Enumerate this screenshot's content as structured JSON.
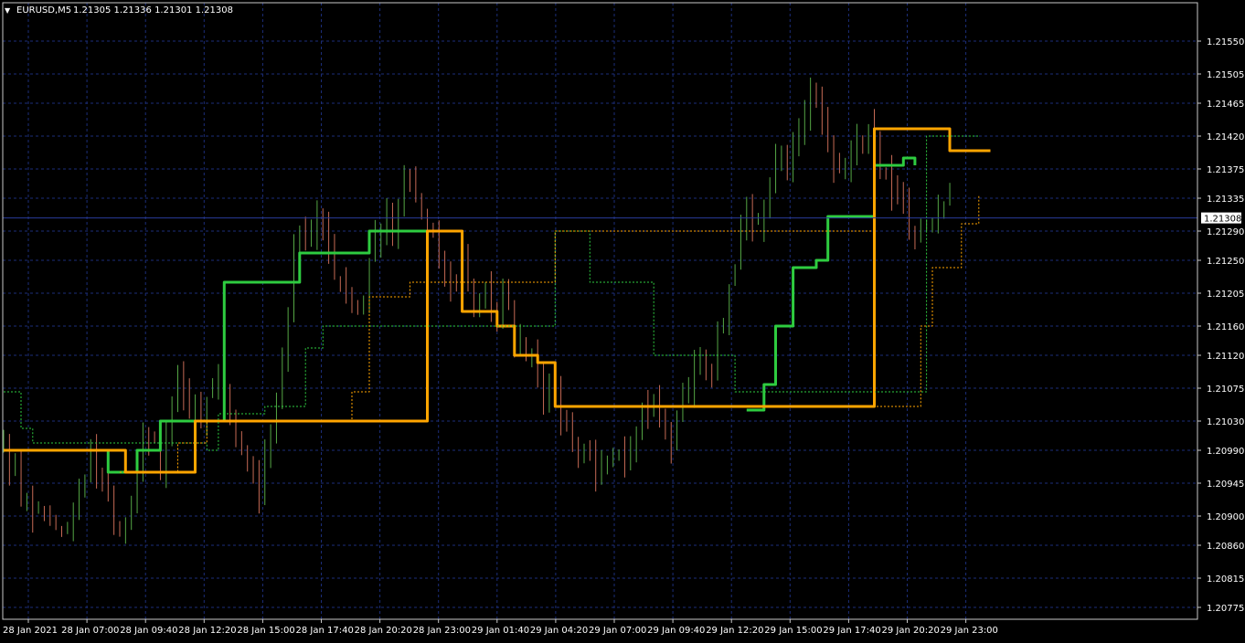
{
  "header": {
    "menu_glyph": "▼",
    "symbol_label": "EURUSD,M5",
    "ohlc_label": "1.21305 1.21336 1.21301 1.21308"
  },
  "colors": {
    "background": "#000000",
    "grid": "#1c2e7a",
    "frame": "#c8c8c8",
    "axis_text": "#ffffff",
    "bull_candle": "#55a645",
    "bear_candle": "#c66a55",
    "green_line": "#2ecc40",
    "orange_line": "#ffa500",
    "price_line": "#2a3c9a"
  },
  "chart_data": {
    "type": "candlestick",
    "symbol": "EURUSD",
    "timeframe": "M5",
    "ylim": [
      1.20775,
      1.21575
    ],
    "y_ticks": [
      "1.21550",
      "1.21505",
      "1.21465",
      "1.21420",
      "1.21375",
      "1.21335",
      "1.21290",
      "1.21250",
      "1.21205",
      "1.21160",
      "1.21120",
      "1.21075",
      "1.21030",
      "1.20990",
      "1.20945",
      "1.20900",
      "1.20860",
      "1.20815",
      "1.20775"
    ],
    "x_ticks": [
      "28 Jan 2021",
      "28 Jan 07:00",
      "28 Jan 09:40",
      "28 Jan 12:20",
      "28 Jan 15:00",
      "28 Jan 17:40",
      "28 Jan 20:20",
      "28 Jan 23:00",
      "29 Jan 01:40",
      "29 Jan 04:20",
      "29 Jan 07:00",
      "29 Jan 09:40",
      "29 Jan 12:20",
      "29 Jan 15:00",
      "29 Jan 17:40",
      "29 Jan 20:20",
      "29 Jan 23:00"
    ],
    "current_price": "1.21308",
    "close_path": [
      [
        0,
        1.20985
      ],
      [
        1,
        1.2096
      ],
      [
        2,
        1.2092
      ],
      [
        3,
        1.2088
      ],
      [
        4,
        1.2091
      ],
      [
        5,
        1.20895
      ],
      [
        6,
        1.2088
      ],
      [
        7,
        1.2092
      ],
      [
        8,
        1.2096
      ],
      [
        9,
        1.2099
      ],
      [
        10,
        1.2094
      ],
      [
        11,
        1.2088
      ],
      [
        12,
        1.2086
      ],
      [
        13,
        1.2093
      ],
      [
        14,
        1.2099
      ],
      [
        15,
        1.2102
      ],
      [
        16,
        1.2097
      ],
      [
        17,
        1.2105
      ],
      [
        18,
        1.211
      ],
      [
        19,
        1.2106
      ],
      [
        20,
        1.2101
      ],
      [
        21,
        1.2106
      ],
      [
        22,
        1.2109
      ],
      [
        23,
        1.2103
      ],
      [
        24,
        1.21
      ],
      [
        25,
        1.2096
      ],
      [
        26,
        1.2092
      ],
      [
        27,
        1.2099
      ],
      [
        28,
        1.2105
      ],
      [
        29,
        1.212
      ],
      [
        30,
        1.2129
      ],
      [
        31,
        1.2126
      ],
      [
        32,
        1.2131
      ],
      [
        33,
        1.2126
      ],
      [
        34,
        1.2123
      ],
      [
        35,
        1.2121
      ],
      [
        36,
        1.2119
      ],
      [
        37,
        1.2122
      ],
      [
        38,
        1.2127
      ],
      [
        39,
        1.2131
      ],
      [
        40,
        1.213
      ],
      [
        41,
        1.2137
      ],
      [
        42,
        1.2134
      ],
      [
        43,
        1.2131
      ],
      [
        44,
        1.2126
      ],
      [
        45,
        1.2122
      ],
      [
        46,
        1.2118
      ],
      [
        47,
        1.2125
      ],
      [
        48,
        1.212
      ],
      [
        49,
        1.2123
      ],
      [
        50,
        1.2118
      ],
      [
        51,
        1.212
      ],
      [
        52,
        1.2115
      ],
      [
        53,
        1.211
      ],
      [
        54,
        1.2112
      ],
      [
        55,
        1.2108
      ],
      [
        56,
        1.2105
      ],
      [
        57,
        1.2103
      ],
      [
        58,
        1.21
      ],
      [
        59,
        1.2098
      ],
      [
        60,
        1.2096
      ],
      [
        61,
        1.2097
      ],
      [
        62,
        1.2099
      ],
      [
        63,
        1.2096
      ],
      [
        64,
        1.21
      ],
      [
        65,
        1.2104
      ],
      [
        66,
        1.2106
      ],
      [
        67,
        1.2102
      ],
      [
        68,
        1.21
      ],
      [
        69,
        1.2104
      ],
      [
        70,
        1.2108
      ],
      [
        71,
        1.2112
      ],
      [
        72,
        1.211
      ],
      [
        73,
        1.2116
      ],
      [
        74,
        1.2122
      ],
      [
        75,
        1.2127
      ],
      [
        76,
        1.2132
      ],
      [
        77,
        1.213
      ],
      [
        78,
        1.2136
      ],
      [
        79,
        1.214
      ],
      [
        80,
        1.2138
      ],
      [
        81,
        1.2143
      ],
      [
        82,
        1.2146
      ],
      [
        83,
        1.2149
      ],
      [
        84,
        1.2142
      ],
      [
        85,
        1.2136
      ],
      [
        86,
        1.2139
      ],
      [
        87,
        1.2142
      ],
      [
        88,
        1.2143
      ],
      [
        89,
        1.2139
      ],
      [
        90,
        1.2135
      ],
      [
        91,
        1.2132
      ],
      [
        92,
        1.213
      ],
      [
        93,
        1.2129
      ],
      [
        94,
        1.2131
      ],
      [
        95,
        1.213
      ],
      [
        96,
        1.2134
      ],
      [
        97,
        1.21308
      ]
    ],
    "series": [
      {
        "name": "",
        "color": "#2ecc40",
        "style": "solid-thick",
        "points": [
          [
            0,
            1.2099
          ],
          [
            17,
            1.2099
          ],
          [
            18,
            1.2096
          ],
          [
            21,
            1.2096
          ],
          [
            23,
            1.2099
          ],
          [
            25,
            1.2099
          ],
          [
            27,
            1.2103
          ],
          [
            35,
            1.2103
          ],
          [
            38,
            1.2122
          ],
          [
            48,
            1.2122
          ],
          [
            51,
            1.2126
          ],
          [
            60,
            1.2126
          ],
          [
            63,
            1.2129
          ],
          [
            73,
            1.2129
          ]
        ]
      },
      {
        "name": "",
        "color": "#2ecc40",
        "style": "solid-thick",
        "points": [
          [
            128,
            1.21045
          ],
          [
            131,
            1.2108
          ],
          [
            133,
            1.2116
          ],
          [
            136,
            1.2124
          ],
          [
            140,
            1.2125
          ],
          [
            142,
            1.2131
          ],
          [
            148,
            1.2131
          ],
          [
            150,
            1.2138
          ],
          [
            155,
            1.2139
          ],
          [
            157,
            1.2138
          ]
        ]
      },
      {
        "name": "",
        "color": "#ffa500",
        "style": "solid-thick",
        "points": [
          [
            0,
            1.2099
          ],
          [
            19,
            1.2099
          ],
          [
            21,
            1.2096
          ],
          [
            30,
            1.2096
          ],
          [
            33,
            1.2103
          ],
          [
            36,
            1.2103
          ],
          [
            73,
            1.2129
          ],
          [
            77,
            1.2129
          ],
          [
            79,
            1.2118
          ],
          [
            85,
            1.2116
          ],
          [
            88,
            1.2112
          ],
          [
            92,
            1.2111
          ],
          [
            95,
            1.2105
          ],
          [
            102,
            1.2105
          ],
          [
            128,
            1.2105
          ],
          [
            150,
            1.2143
          ],
          [
            160,
            1.2143
          ],
          [
            163,
            1.214
          ],
          [
            170,
            1.214
          ]
        ]
      },
      {
        "name": "",
        "color": "#2ecc40",
        "style": "dashed",
        "points": [
          [
            0,
            1.2107
          ],
          [
            3,
            1.2102
          ],
          [
            5,
            1.21
          ],
          [
            28,
            1.21
          ],
          [
            35,
            1.2099
          ],
          [
            37,
            1.2104
          ],
          [
            45,
            1.2105
          ],
          [
            52,
            1.2113
          ],
          [
            55,
            1.2116
          ],
          [
            65,
            1.2116
          ],
          [
            95,
            1.2129
          ],
          [
            101,
            1.2122
          ],
          [
            112,
            1.2112
          ],
          [
            126,
            1.2107
          ],
          [
            150,
            1.2107
          ],
          [
            159,
            1.2142
          ],
          [
            168,
            1.2142
          ]
        ]
      },
      {
        "name": "",
        "color": "#ffa500",
        "style": "dashed",
        "points": [
          [
            20,
            1.2096
          ],
          [
            26,
            1.2096
          ],
          [
            30,
            1.21
          ],
          [
            35,
            1.2103
          ],
          [
            58,
            1.2103
          ],
          [
            60,
            1.2107
          ],
          [
            63,
            1.212
          ],
          [
            70,
            1.2122
          ],
          [
            95,
            1.2129
          ],
          [
            150,
            1.2105
          ],
          [
            158,
            1.2116
          ],
          [
            160,
            1.2124
          ],
          [
            165,
            1.213
          ],
          [
            168,
            1.2134
          ]
        ]
      }
    ]
  }
}
